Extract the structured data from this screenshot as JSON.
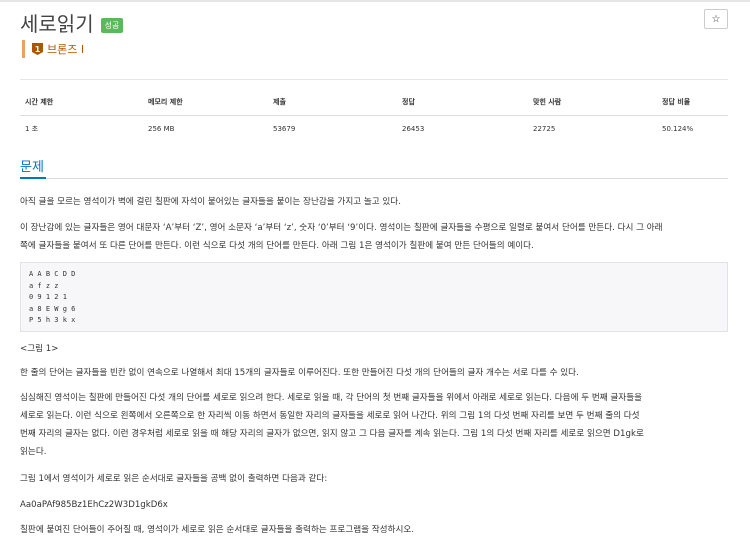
{
  "problem": {
    "title": "세로읽기",
    "status_badge": "성공",
    "star_icon": "☆",
    "tier": {
      "icon": "1",
      "label": "브론즈 I",
      "color": "#ad5600"
    }
  },
  "info_table": {
    "headers": [
      "시간 제한",
      "메모리 제한",
      "제출",
      "정답",
      "맞힌 사람",
      "정답 비율"
    ],
    "values": [
      "1 초",
      "256 MB",
      "53679",
      "26453",
      "22725",
      "50.124%"
    ]
  },
  "section": {
    "title": "문제",
    "p1": "아직 글을 모르는 영석이가 벽에 걸린 칠판에 자석이 붙어있는 글자들을 붙이는 장난감을 가지고 놀고 있다.",
    "p2a": "이 장난감에 있는 글자들은 영어 대문자 ‘A’부터 ‘Z’, 영어 소문자 ‘a’부터 ‘z’, 숫자 ‘0’부터 ‘9’이다. 영석이는 칠판에 글자들을 수평으로 일렬로 붙여서 단어를 만든다. 다시 그 아래",
    "p2b": "쪽에 글자들을 붙여서 또 다른 단어를 만든다. 이런 식으로 다섯 개의 단어를 만든다. 아래 그림 1은 영석이가 칠판에 붙여 만든 단어들의 예이다.",
    "code_lines": [
      "A A B C D D",
      "a f z z",
      "0 9 1 2 1",
      "a 8 E W g 6",
      "P 5 h 3 k x"
    ],
    "figure_caption": "<그림 1>",
    "p3": "한 줄의 단어는 글자들을 빈칸 없이 연속으로 나열해서 최대 15개의 글자들로 이루어진다. 또한 만들어진 다섯 개의 단어들의 글자 개수는 서로 다를 수 있다.",
    "p4a": "심심해진 영석이는 칠판에 만들어진 다섯 개의 단어를 세로로 읽으려 한다. 세로로 읽을 때, 각 단어의 첫 번째 글자들을 위에서 아래로 세로로 읽는다. 다음에 두 번째 글자들을",
    "p4b": "세로로 읽는다. 이런 식으로 왼쪽에서 오른쪽으로 한 자리씩 이동 하면서 동일한 자리의 글자들을 세로로 읽어 나간다. 위의 그림 1의 다섯 번째 자리를 보면 두 번째 줄의 다섯",
    "p4c": "번째 자리의 글자는 없다. 이런 경우처럼 세로로 읽을 때 해당 자리의 글자가 없으면, 읽지 않고 그 다음 글자를 계속 읽는다. 그림 1의 다섯 번째 자리를 세로로 읽으면 D1gk로",
    "p4d": "읽는다.",
    "p5": "그림 1에서 영석이가 세로로 읽은 순서대로 글자들을 공백 없이 출력하면 다음과 같다:",
    "p6": "Aa0aPAf985Bz1EhCz2W3D1gkD6x",
    "p7": "칠판에 붙여진 단어들이 주어질 때, 영석이가 세로로 읽은 순서대로 글자들을 출력하는 프로그램을 작성하시오."
  }
}
